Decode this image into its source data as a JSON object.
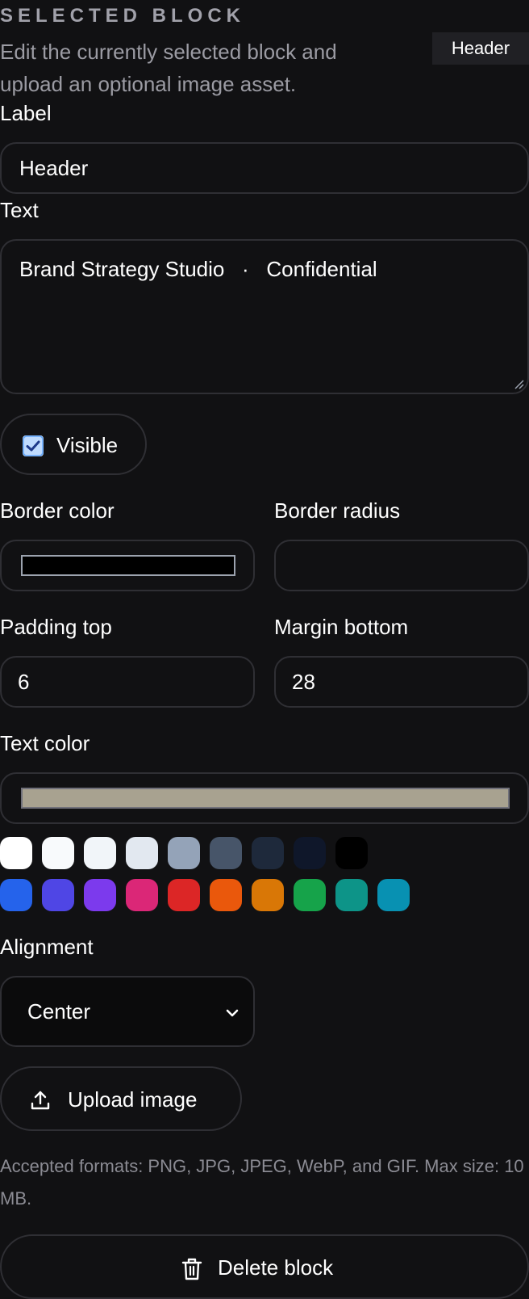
{
  "section": {
    "eyebrow": "SELECTED BLOCK",
    "description": "Edit the currently selected block and upload an optional image asset.",
    "badge": "Header"
  },
  "fields": {
    "label": {
      "label": "Label",
      "value": "Header"
    },
    "text": {
      "label": "Text",
      "value": "Brand Strategy Studio   ·   Confidential"
    },
    "visible": {
      "label": "Visible",
      "checked": true
    },
    "border_color": {
      "label": "Border color",
      "value": "#000000"
    },
    "border_radius": {
      "label": "Border radius",
      "value": ""
    },
    "padding_top": {
      "label": "Padding top",
      "value": "6"
    },
    "margin_bottom": {
      "label": "Margin bottom",
      "value": "28"
    },
    "text_color": {
      "label": "Text color",
      "value": "#a8a290"
    },
    "alignment": {
      "label": "Alignment",
      "value": "Center"
    }
  },
  "palette": [
    "#ffffff",
    "#f8fafc",
    "#f1f5f9",
    "#e2e8f0",
    "#94a3b8",
    "#475569",
    "#1e293b",
    "#0f172a",
    "#000000",
    "#2563eb",
    "#4f46e5",
    "#7c3aed",
    "#db2777",
    "#dc2626",
    "#ea580c",
    "#d97706",
    "#16a34a",
    "#0d9488",
    "#0891b2"
  ],
  "upload": {
    "button_label": "Upload image",
    "hint": "Accepted formats: PNG, JPG, JPEG, WebP, and GIF. Max size: 10 MB.",
    "icon": "upload-icon"
  },
  "delete": {
    "button_label": "Delete block",
    "icon": "trash-icon"
  }
}
